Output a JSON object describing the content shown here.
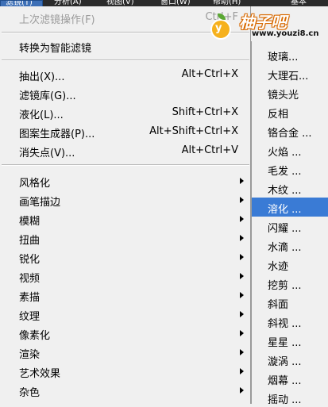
{
  "menubar": {
    "items": [
      "滤镜(T)",
      "分析(A)",
      "视图(V)",
      "窗口(W)",
      "帮助(H)",
      "基本"
    ]
  },
  "menu": {
    "last_filter": {
      "label": "上次滤镜操作(F)",
      "shortcut": "Ctrl+F"
    },
    "convert_smart": {
      "label": "转换为智能滤镜"
    },
    "commands": [
      {
        "label": "抽出(X)...",
        "shortcut": "Alt+Ctrl+X"
      },
      {
        "label": "滤镜库(G)...",
        "shortcut": ""
      },
      {
        "label": "液化(L)...",
        "shortcut": "Shift+Ctrl+X"
      },
      {
        "label": "图案生成器(P)...",
        "shortcut": "Alt+Shift+Ctrl+X"
      },
      {
        "label": "消失点(V)...",
        "shortcut": "Alt+Ctrl+V"
      }
    ],
    "categories": [
      "风格化",
      "画笔描边",
      "模糊",
      "扭曲",
      "锐化",
      "视频",
      "素描",
      "纹理",
      "像素化",
      "渲染",
      "艺术效果",
      "杂色"
    ]
  },
  "submenu": {
    "items": [
      "玻璃...",
      "大理石...",
      "镜头光",
      "反相",
      "铬合金 ...",
      "火焰 ...",
      "毛发 ...",
      "木纹 ...",
      "溶化 ...",
      "闪耀 ...",
      "水滴 ...",
      "水迹",
      "挖剪 ...",
      "斜面",
      "斜视 ...",
      "星星 ...",
      "漩涡 ...",
      "烟幕 ...",
      "摇动 ..."
    ],
    "highlighted_index": 8
  },
  "watermark": {
    "title": "柚子吧",
    "url": "www.youzi8.cn",
    "badge": "y"
  },
  "colors": {
    "menu_bg": "#f0f0f0",
    "highlight": "#3a7bd5",
    "disabled": "#9b9b9b"
  }
}
